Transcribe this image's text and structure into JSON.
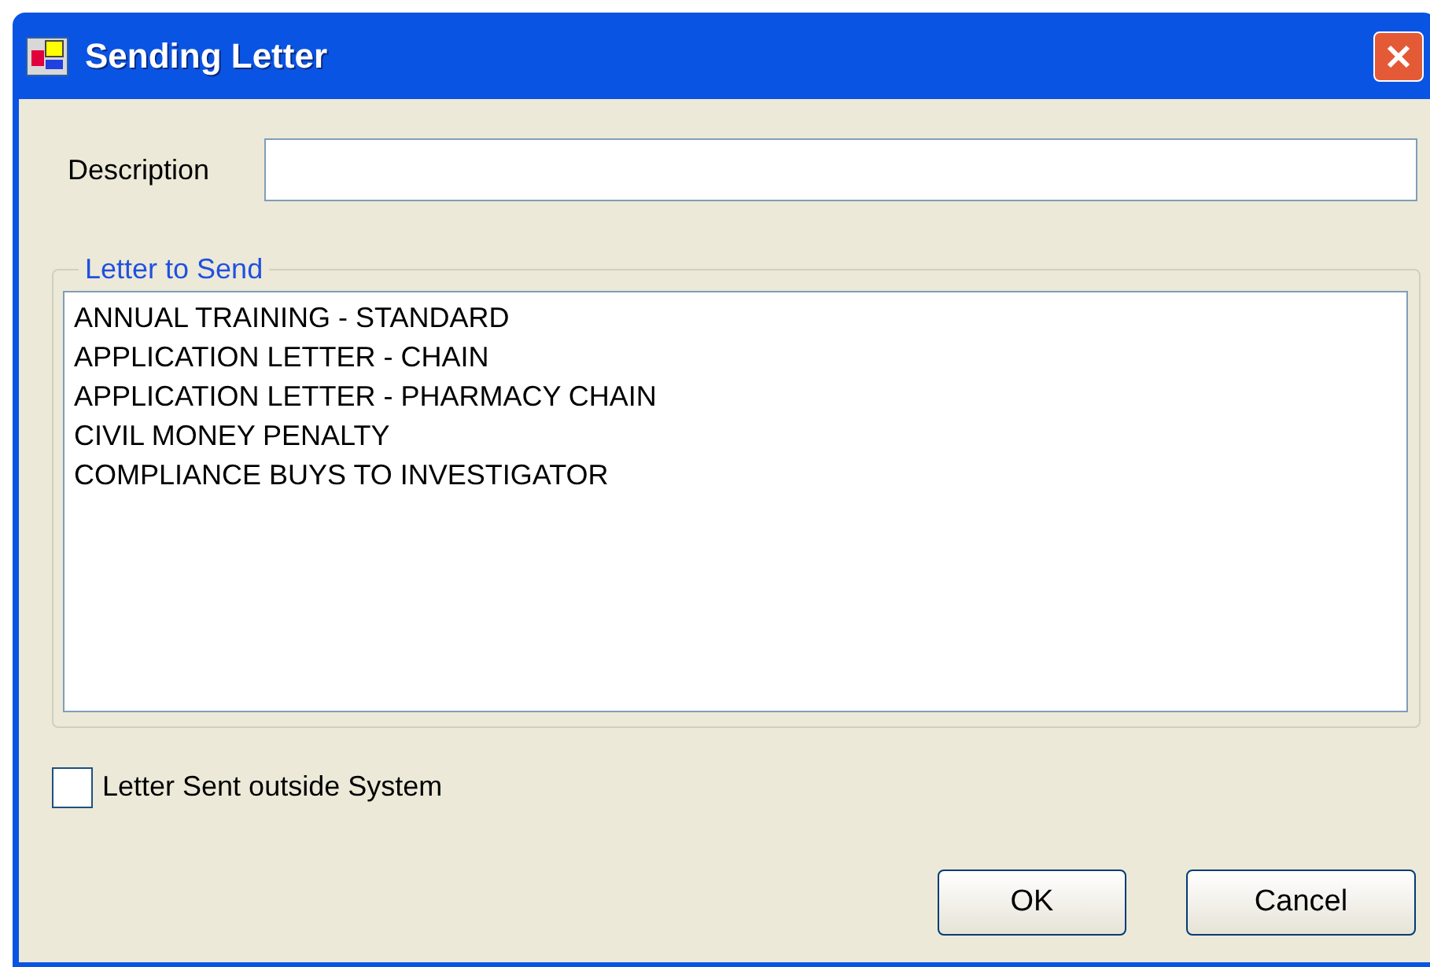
{
  "window": {
    "title": "Sending Letter"
  },
  "description": {
    "label": "Description"
  },
  "letter_group": {
    "legend": "Letter to Send",
    "items": [
      {
        "label": "ANNUAL TRAINING - STANDARD",
        "selected": false
      },
      {
        "label": "APPLICATION LETTER - CHAIN",
        "selected": false
      },
      {
        "label": "APPLICATION LETTER - PHARMACY CHAIN",
        "selected": false
      },
      {
        "label": "CIVIL MONEY PENALTY",
        "selected": false
      },
      {
        "label": "COMPLIANCE BUYS TO INVESTIGATOR",
        "selected": false
      }
    ]
  },
  "outside_system": {
    "label": "Letter Sent outside System",
    "checked": false
  },
  "buttons": [
    "OK",
    "Cancel"
  ]
}
